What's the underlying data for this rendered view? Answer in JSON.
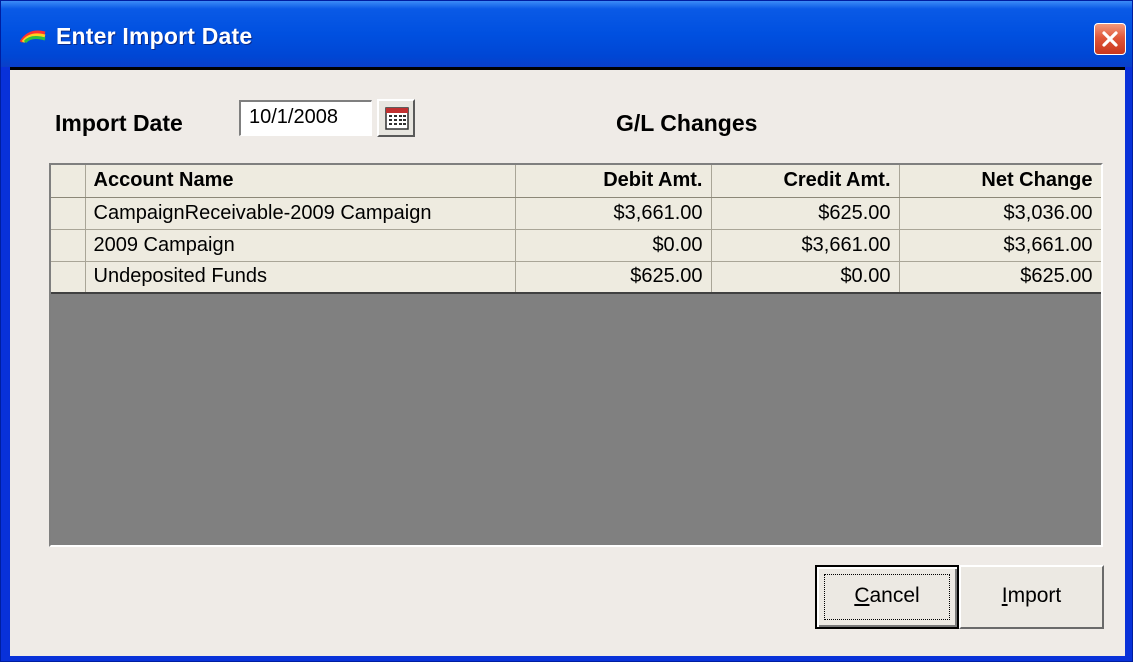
{
  "window": {
    "title": "Enter Import Date"
  },
  "form": {
    "import_date_label": "Import Date",
    "import_date_value": "10/1/2008"
  },
  "gl": {
    "heading": "G/L Changes",
    "columns": [
      "Account Name",
      "Debit Amt.",
      "Credit Amt.",
      "Net Change"
    ],
    "rows": [
      [
        "CampaignReceivable-2009 Campaign",
        "$3,661.00",
        "$625.00",
        "$3,036.00"
      ],
      [
        "2009 Campaign",
        "$0.00",
        "$3,661.00",
        "$3,661.00"
      ],
      [
        "Undeposited Funds",
        "$625.00",
        "$0.00",
        "$625.00"
      ]
    ]
  },
  "buttons": {
    "cancel_access": "C",
    "cancel_rest": "ancel",
    "import_access": "I",
    "import_rest": "mport"
  },
  "colors": {
    "titlebar": "#0050e0",
    "close": "#e0573a",
    "dialog_bg": "#efebe7",
    "grid_empty": "#808080"
  },
  "icons": {
    "app": "rainbow-arc-icon",
    "close": "close-icon",
    "calendar": "calendar-icon"
  }
}
